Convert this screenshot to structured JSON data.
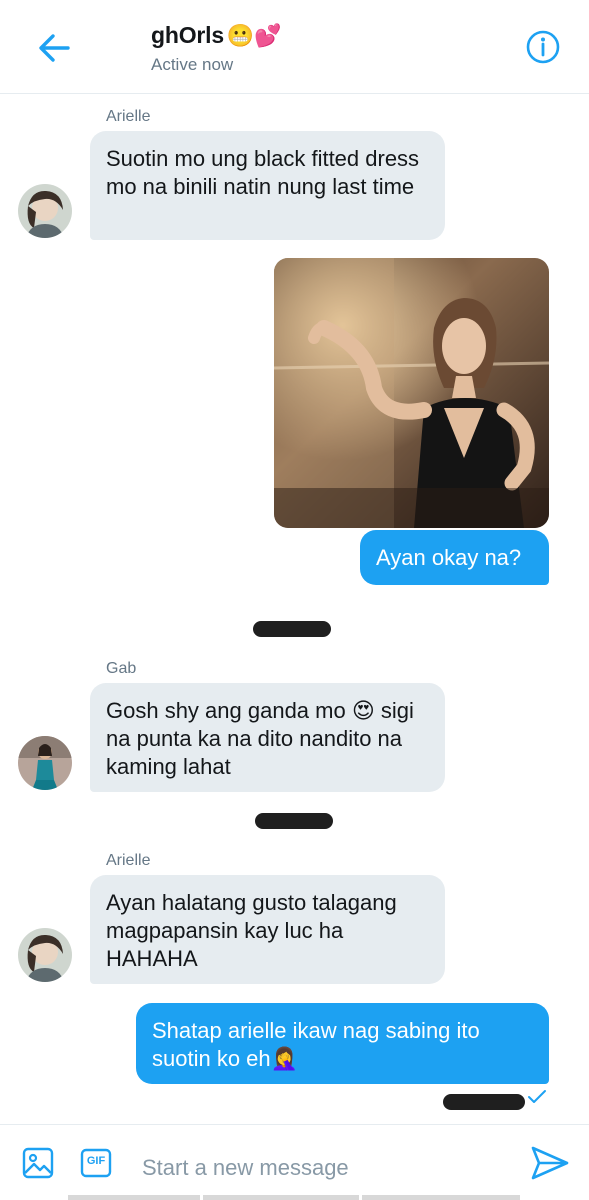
{
  "header": {
    "title": "ghOrls",
    "title_emojis": "😬💕",
    "status": "Active now"
  },
  "messages": [
    {
      "type": "incoming",
      "sender": "Arielle",
      "text": "Suotin mo ung black fitted dress mo na binili natin nung last time"
    },
    {
      "type": "outgoing-image",
      "image": "photo of woman in black dress by a mirror"
    },
    {
      "type": "outgoing",
      "text": "Ayan okay na?"
    },
    {
      "type": "incoming",
      "sender": "Gab",
      "text": "Gosh shy ang ganda mo 😍 sigi na punta ka na dito nandito na kaming lahat"
    },
    {
      "type": "incoming",
      "sender": "Arielle",
      "text": "Ayan halatang gusto talagang magpapansin kay luc ha HAHAHA"
    },
    {
      "type": "outgoing",
      "text": "Shatap arielle ikaw nag sabing ito suotin ko eh🤦‍♀️"
    }
  ],
  "composer": {
    "placeholder": "Start a new message",
    "gif_label": "GIF"
  },
  "colors": {
    "accent": "#1da1f2",
    "incoming_bubble": "#e6ecf0",
    "muted_text": "#657786"
  },
  "icons": [
    "back-arrow-icon",
    "info-icon",
    "image-icon",
    "gif-icon",
    "send-icon",
    "read-check-icon"
  ]
}
